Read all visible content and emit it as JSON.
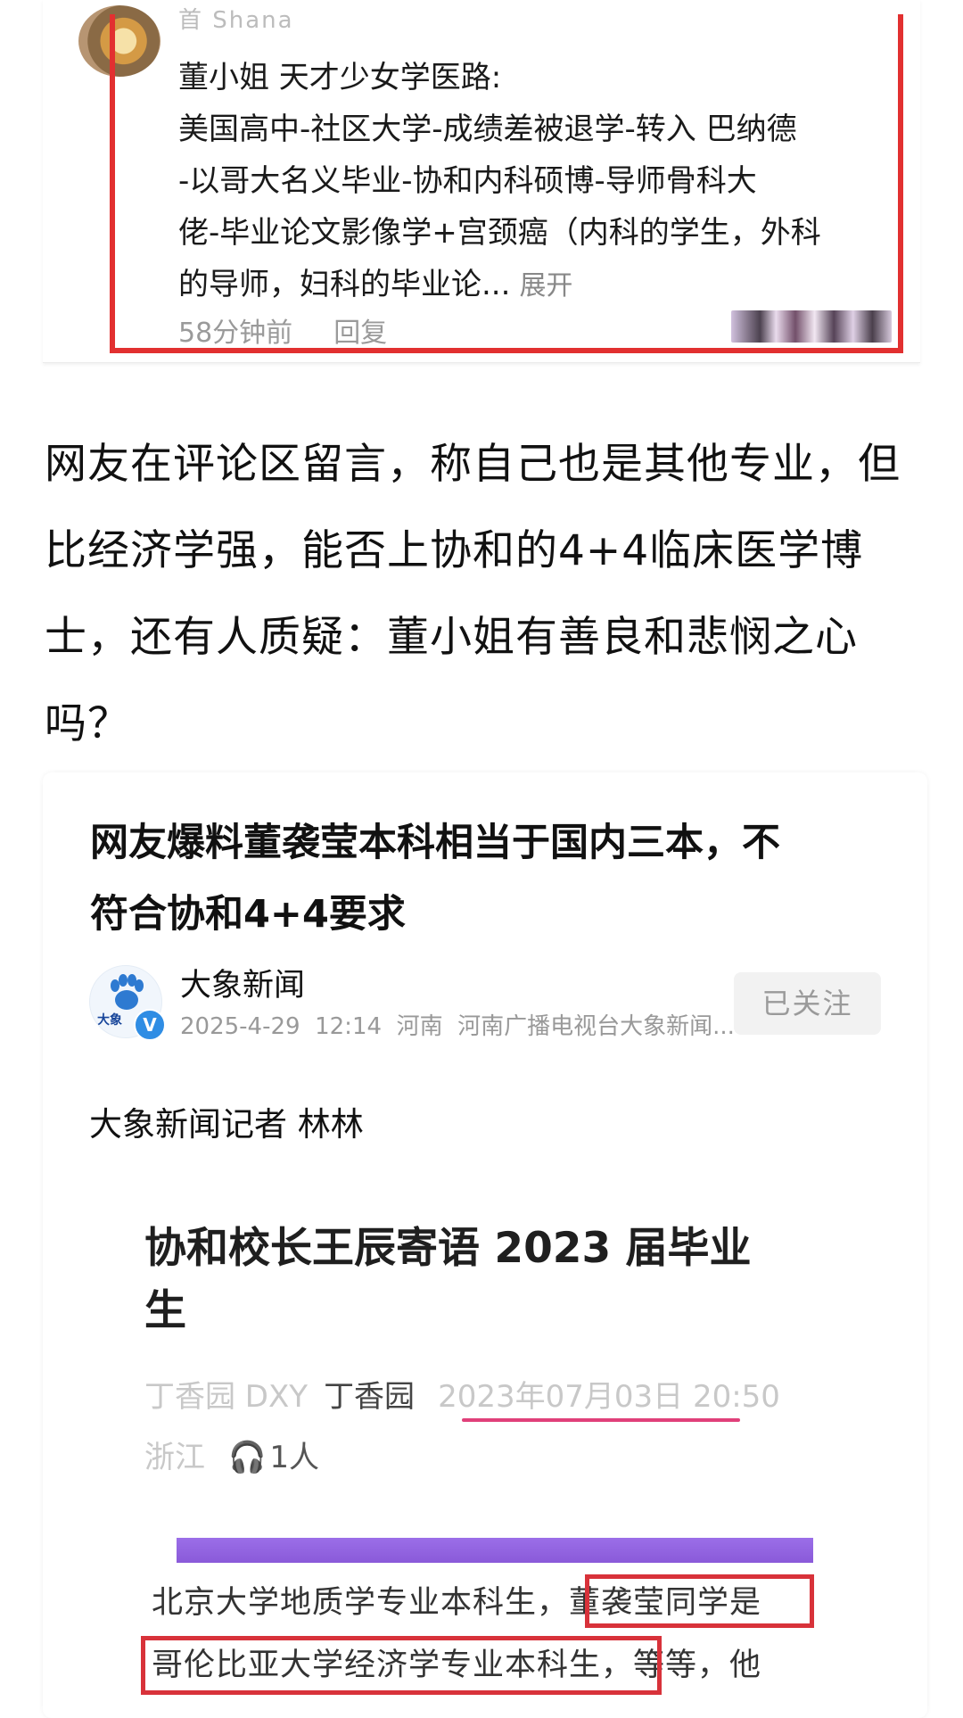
{
  "comment": {
    "user_name_partial": "首          Shana",
    "lines": [
      "董小姐 天才少女学医路:",
      "美国高中-社区大学-成绩差被退学-转入 巴纳德",
      "-以哥大名义毕业-协和内科硕博-导师骨科大",
      "佬-毕业论文影像学+宫颈癌（内科的学生，外科",
      "的导师，妇科的毕业论..."
    ],
    "expand_label": "展开",
    "time": "58分钟前",
    "reply_label": "回复"
  },
  "paragraph": "网友在评论区留言，称自己也是其他专业，但比经济学强，能否上协和的4+4临床医学博士，还有人质疑：董小姐有善良和悲悯之心吗？",
  "article": {
    "title_line1": "网友爆料董袭莹本科相当于国内三本，不",
    "title_line2": "符合协和4+4要求",
    "source_name": "大象新闻",
    "avatar_label": "大象",
    "verified_mark": "V",
    "date": "2025-4-29",
    "time": "12:14",
    "location": "河南",
    "publisher": "河南广播电视台大象新闻...",
    "follow_label": "已关注",
    "reporter": "大象新闻记者 林林"
  },
  "embedded": {
    "title_line1": "协和校长王辰寄语 2023 届毕业",
    "title_line2": "生",
    "account": "丁香园 DXY",
    "author": "丁香园",
    "date": "2023年07月03日",
    "time": "20:50",
    "location": "浙江",
    "listeners": "1人",
    "body_line1": "北京大学地质学专业本科生，董袭莹同学是",
    "body_line2": "哥伦比亚大学经济学专业本科生，等等，他"
  },
  "colors": {
    "highlight_red": "#e23030",
    "underline_pink": "#e0407a",
    "verified_blue": "#2f8de4",
    "banner_purple": "#8a5ad9"
  }
}
